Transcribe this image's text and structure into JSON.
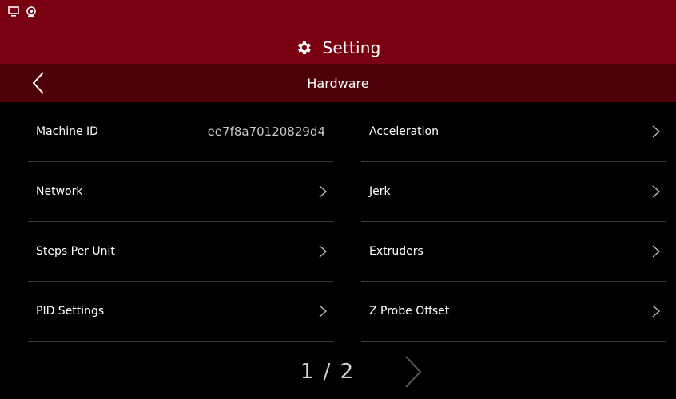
{
  "header": {
    "status_icons": [
      "monitor-icon",
      "webcam-icon"
    ],
    "title": "Setting",
    "title_icon": "gear-icon"
  },
  "subheader": {
    "title": "Hardware",
    "back_icon": "chevron-left-icon"
  },
  "left_items": [
    {
      "label": "Machine ID",
      "value": "ee7f8a70120829d4"
    },
    {
      "label": "Network"
    },
    {
      "label": "Steps Per Unit"
    },
    {
      "label": "PID Settings"
    }
  ],
  "right_items": [
    {
      "label": "Acceleration"
    },
    {
      "label": "Jerk"
    },
    {
      "label": "Extruders"
    },
    {
      "label": "Z Probe Offset"
    }
  ],
  "pager": {
    "text": "1 / 2",
    "next_icon": "chevron-right-icon"
  },
  "colors": {
    "header_bg": "#780010",
    "subheader_bg": "#4e0008",
    "body_bg": "#000000",
    "divider": "#3a3a3a"
  }
}
